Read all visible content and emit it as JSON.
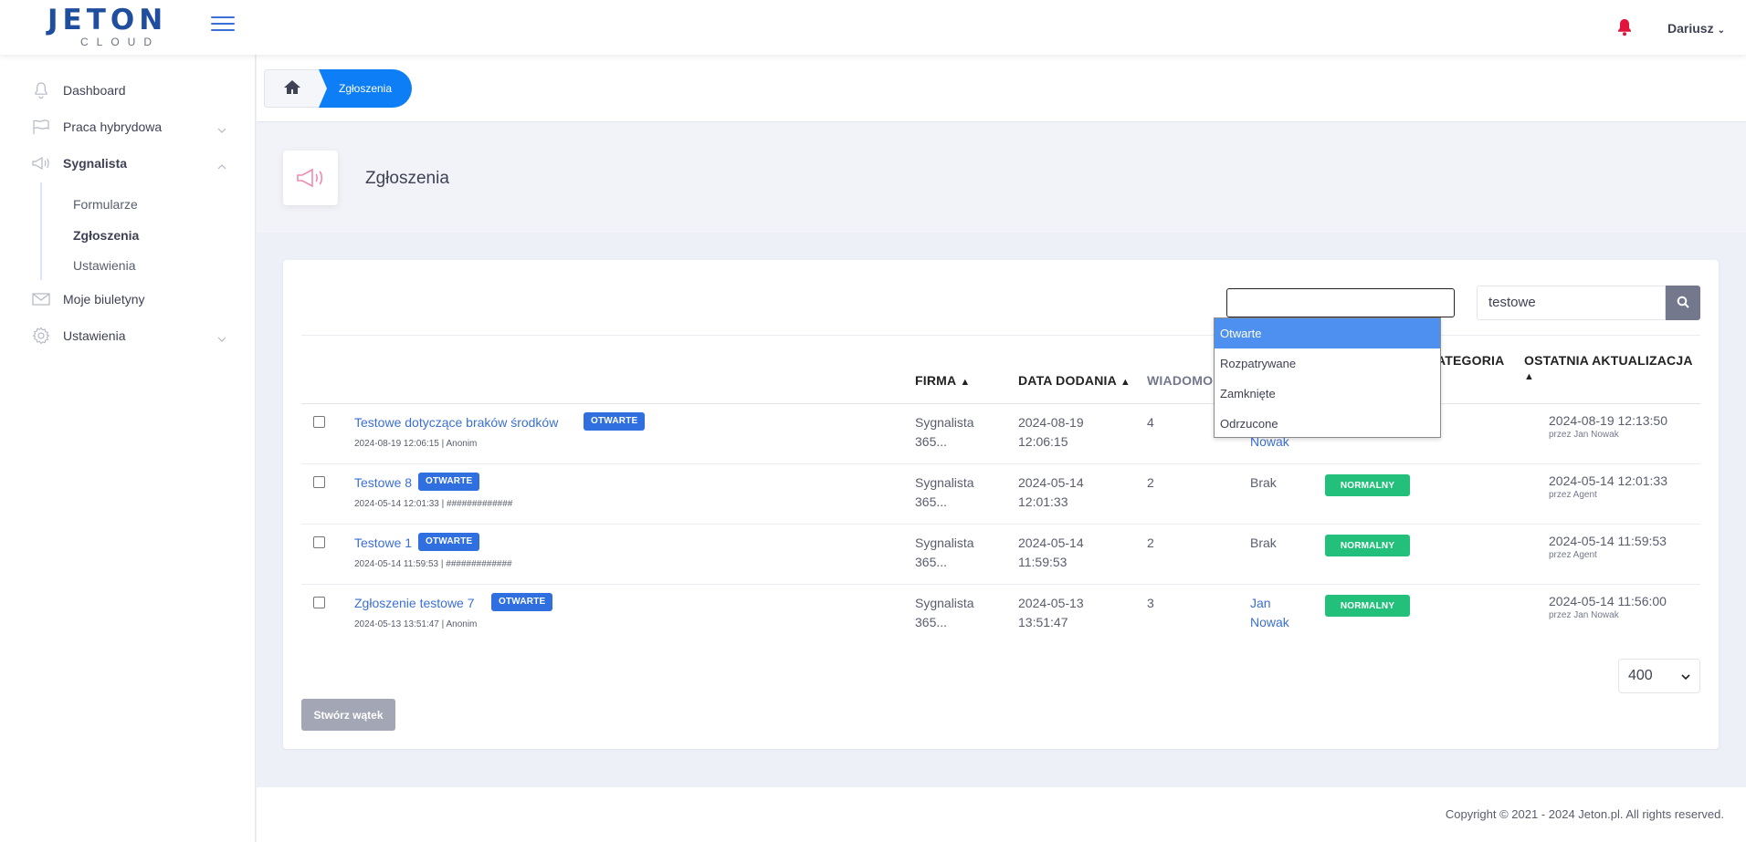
{
  "brand": {
    "logo_top": "JETON",
    "logo_bottom": "CLOUD",
    "accent": "#0d7ef5",
    "badge_color": "#2f6fe0",
    "priority_color": "#22c07a"
  },
  "header": {
    "user_name": "Dariusz",
    "notification_icon": "bell-icon",
    "menu_icon": "hamburger-icon"
  },
  "sidebar": {
    "items": [
      {
        "label": "Dashboard",
        "icon": "bell-icon"
      },
      {
        "label": "Praca hybrydowa",
        "icon": "flag-icon"
      },
      {
        "label": "Sygnalista",
        "icon": "megaphone-icon"
      },
      {
        "label": "Moje biuletyny",
        "icon": "envelope-icon"
      },
      {
        "label": "Ustawienia",
        "icon": "gear-icon"
      }
    ],
    "sub_items": [
      {
        "label": "Formularze"
      },
      {
        "label": "Zgłoszenia"
      },
      {
        "label": "Ustawienia"
      }
    ]
  },
  "breadcrumb": {
    "home_icon": "home-icon",
    "current": "Zgłoszenia"
  },
  "page": {
    "title": "Zgłoszenia",
    "title_icon": "megaphone-icon"
  },
  "filters": {
    "status_value": "",
    "status_options": [
      "Otwarte",
      "Rozpatrywane",
      "Zamknięte",
      "Odrzucone"
    ],
    "search_value": "testowe",
    "search_icon": "search-icon"
  },
  "table": {
    "headers": {
      "firma": "FIRMA",
      "data": "DATA DODANIA",
      "wiadomosci": "WIADOMO",
      "kategoria": "ATEGORIA",
      "aktualizacja": "OSTATNIA AKTUALIZACJA"
    },
    "rows": [
      {
        "title": "Testowe dotyczące braków środków",
        "status": "OTWARTE",
        "meta": "2024-08-19 12:06:15 | Anonim",
        "firma_1": "Sygnalista",
        "firma_2": "365...",
        "date_1": "2024-08-19",
        "date_2": "12:06:15",
        "messages": "4",
        "assignee_1": "",
        "assignee_2": "Nowak",
        "priority": "",
        "updated": "2024-08-19 12:13:50",
        "updated_by": "przez Jan Nowak"
      },
      {
        "title": "Testowe 8",
        "status": "OTWARTE",
        "meta": "2024-05-14 12:01:33 | #############",
        "firma_1": "Sygnalista",
        "firma_2": "365...",
        "date_1": "2024-05-14",
        "date_2": "12:01:33",
        "messages": "2",
        "assignee_1": "Brak",
        "assignee_2": "",
        "priority": "NORMALNY",
        "updated": "2024-05-14 12:01:33",
        "updated_by": "przez Agent"
      },
      {
        "title": "Testowe 1",
        "status": "OTWARTE",
        "meta": "2024-05-14 11:59:53 | #############",
        "firma_1": "Sygnalista",
        "firma_2": "365...",
        "date_1": "2024-05-14",
        "date_2": "11:59:53",
        "messages": "2",
        "assignee_1": "Brak",
        "assignee_2": "",
        "priority": "NORMALNY",
        "updated": "2024-05-14 11:59:53",
        "updated_by": "przez Agent"
      },
      {
        "title": "Zgłoszenie testowe 7",
        "status": "OTWARTE",
        "meta": "2024-05-13 13:51:47 | Anonim",
        "firma_1": "Sygnalista",
        "firma_2": "365...",
        "date_1": "2024-05-13",
        "date_2": "13:51:47",
        "messages": "3",
        "assignee_1": "Jan",
        "assignee_2": "Nowak",
        "priority": "NORMALNY",
        "updated": "2024-05-14 11:56:00",
        "updated_by": "przez Jan Nowak"
      }
    ]
  },
  "pagination": {
    "page_size": "400"
  },
  "actions": {
    "create_label": "Stwórz wątek"
  },
  "footer": {
    "copyright": "Copyright © 2021 - 2024 Jeton.pl. All rights reserved."
  }
}
